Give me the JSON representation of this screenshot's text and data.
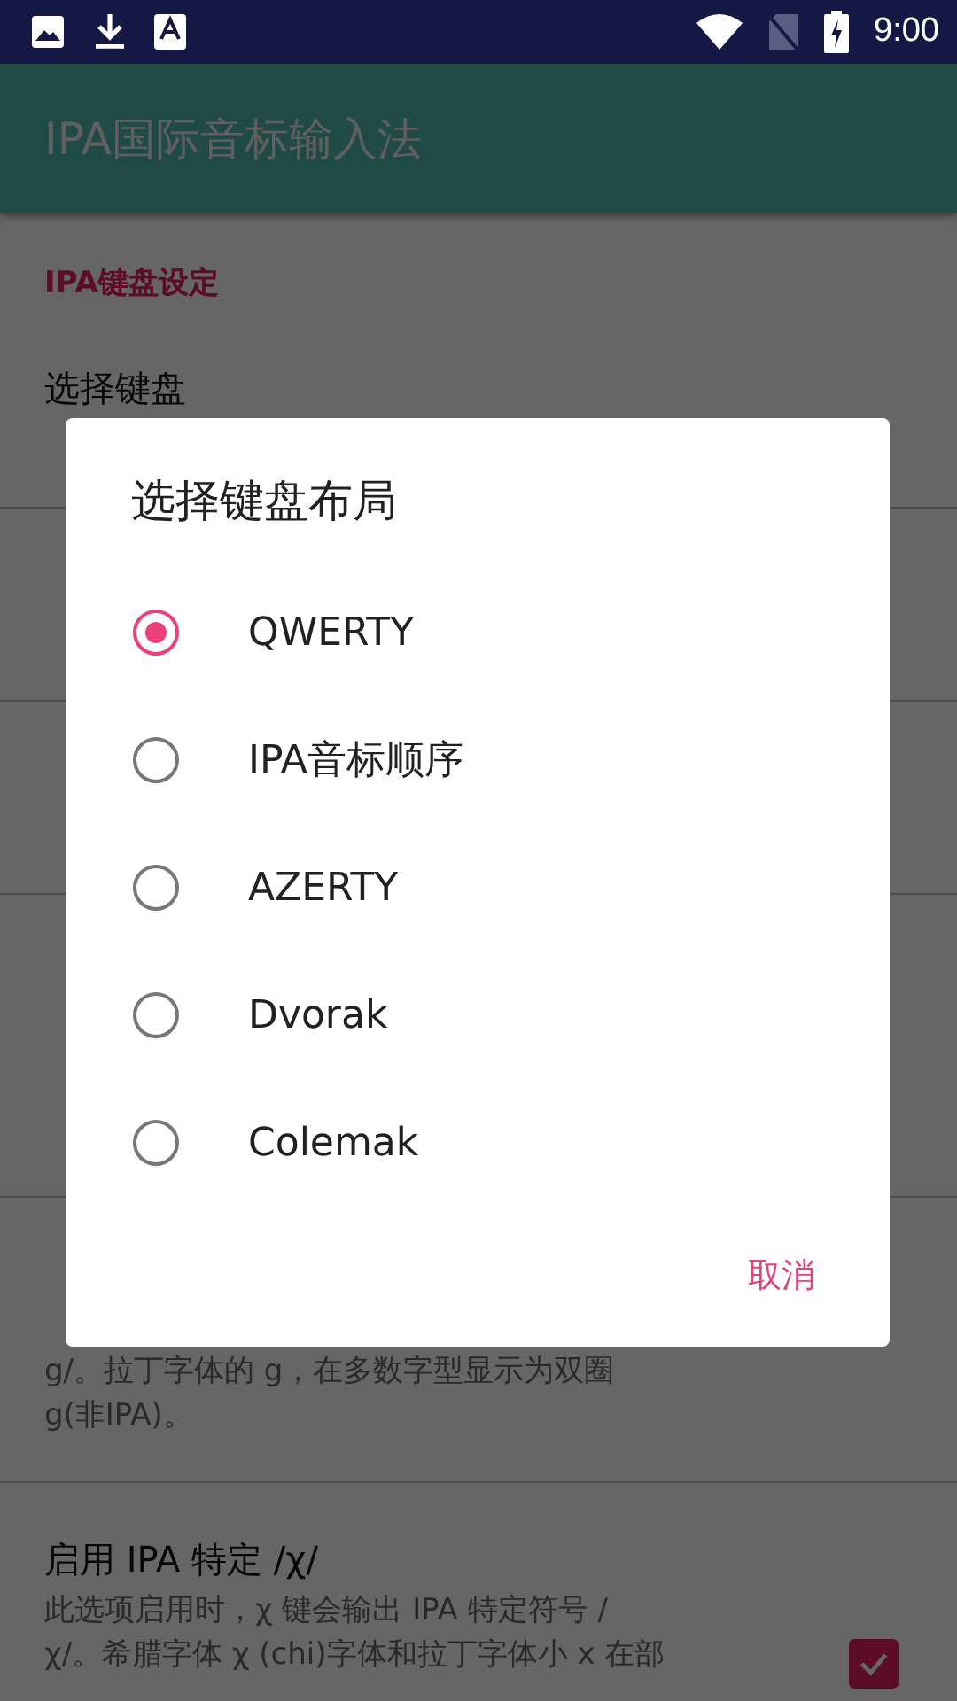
{
  "status_bar": {
    "time": "9:00"
  },
  "app_bar": {
    "title": "IPA国际音标输入法"
  },
  "settings": [
    {
      "kind": "header",
      "title": "IPA键盘设定"
    },
    {
      "kind": "row",
      "title": "选择键盘"
    },
    {
      "kind": "hidden_row"
    },
    {
      "kind": "hidden_row"
    },
    {
      "kind": "hidden_header"
    },
    {
      "kind": "hidden_row"
    },
    {
      "kind": "partial_row",
      "lines": [
        "g/。拉丁字体的 g，在多数字型显示为双圈",
        "g(非IPA)。"
      ]
    },
    {
      "kind": "check",
      "title": "启用 IPA 特定 /χ/",
      "lines": [
        "此选项启用时，χ 键会输出 IPA 特定符号 /",
        "χ/。希腊字体 χ (chi)字体和拉丁字体小 x 在部"
      ],
      "checked": true
    }
  ],
  "dialog": {
    "title": "选择键盘布局",
    "options": [
      {
        "label": "QWERTY",
        "selected": true
      },
      {
        "label": "IPA音标顺序",
        "selected": false
      },
      {
        "label": "AZERTY",
        "selected": false
      },
      {
        "label": "Dvorak",
        "selected": false
      },
      {
        "label": "Colemak",
        "selected": false
      }
    ],
    "cancel": "取消"
  }
}
